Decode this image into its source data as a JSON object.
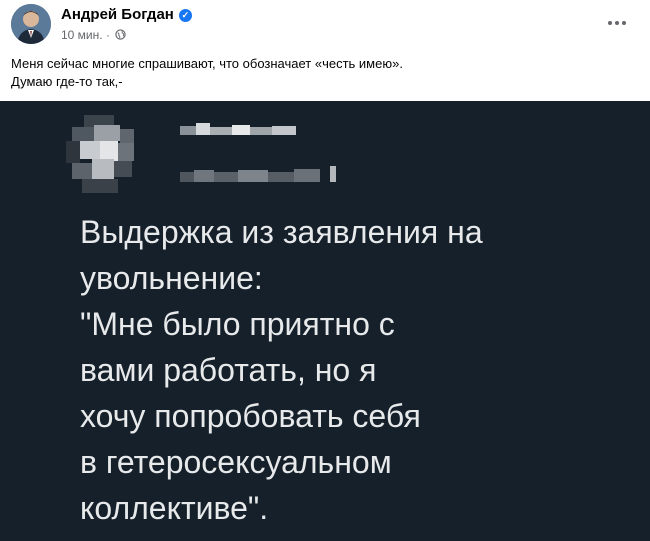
{
  "post": {
    "author": {
      "name": "Андрей Богдан",
      "verified_mark": "✓",
      "avatar_icon": "avatar-photo"
    },
    "time": "10 мин.",
    "separator": "·",
    "audience_icon": "globe-icon",
    "more_icon": "more-options-icon",
    "text_lines": [
      "Меня сейчас многие спрашивают, что обозначает «честь имею».",
      "Думаю где-то так,-"
    ]
  },
  "media": {
    "background": "#15202b",
    "text_color": "#e7e9ea",
    "tweet_lines": [
      "Выдержка из заявления на",
      "увольнение:",
      "\"Мне было приятно с",
      "вами работать, но я",
      "хочу попробовать себя",
      "в гетеросексуальном",
      "коллективе\"."
    ]
  },
  "colors": {
    "verified": "#1877f2",
    "secondary_text": "#65676b"
  }
}
